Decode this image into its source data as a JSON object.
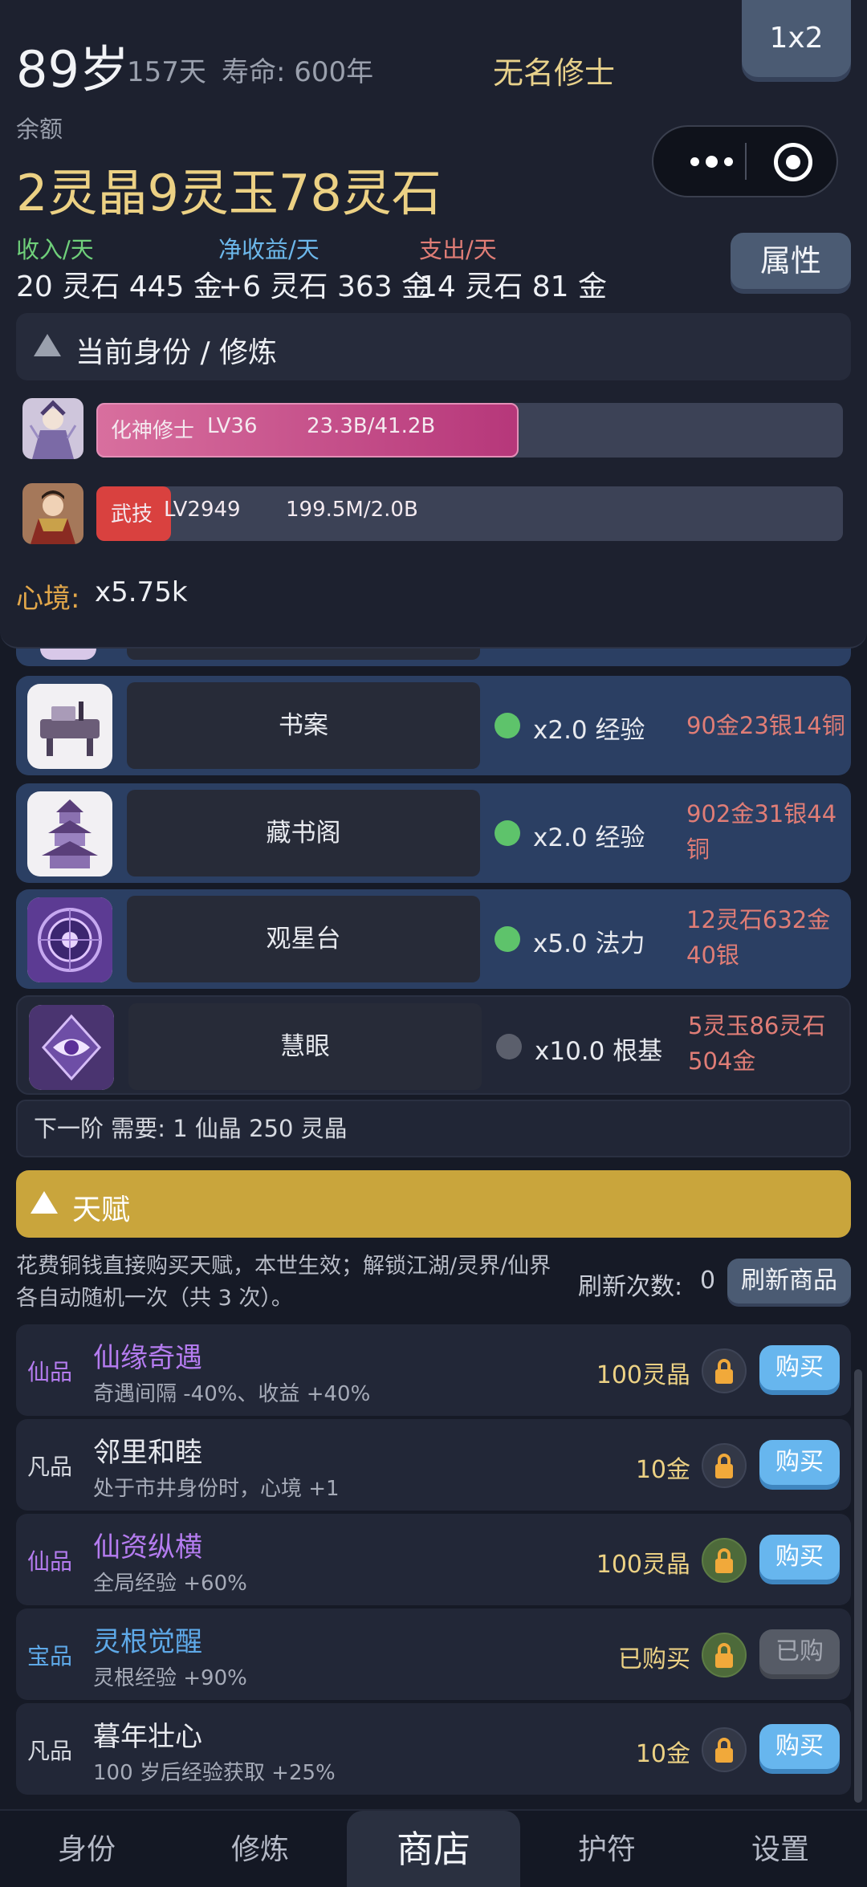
{
  "header": {
    "age": "89岁",
    "days": "157天",
    "lifespan": "寿命: 600年",
    "player_name": "无名修士",
    "layout_button": "1x2",
    "balance_label": "余额",
    "balance": "2灵晶9灵玉78灵石",
    "stats": [
      {
        "label": "收入/天",
        "value": "20 灵石 445 金",
        "color": "#6fcf7a"
      },
      {
        "label": "净收益/天",
        "value": "+6 灵石 363 金",
        "color": "#6cb7ea"
      },
      {
        "label": "支出/天",
        "value": "14 灵石 81 金",
        "color": "#e07d76"
      }
    ],
    "attributes_button": "属性"
  },
  "identity_section": {
    "title": "当前身份 / 修炼",
    "bars": [
      {
        "name": "化神修士",
        "level": "LV36",
        "progress": "23.3B/41.2B",
        "fraction": 0.566,
        "avatar_icon": "immortal-portrait-icon"
      },
      {
        "name": "武技",
        "level": "LV2949",
        "progress": "199.5M/2.0B",
        "fraction": 0.0998,
        "avatar_icon": "warrior-portrait-icon"
      }
    ],
    "mood_label": "心境:",
    "mood_value": "x5.75k"
  },
  "buildings": [
    {
      "name": "书案",
      "bonus": "x2.0 经验",
      "cost": "90金23银14铜",
      "active": true,
      "icon": "desk-icon"
    },
    {
      "name": "藏书阁",
      "bonus": "x2.0 经验",
      "cost": "902金31银44铜",
      "active": true,
      "icon": "pagoda-icon"
    },
    {
      "name": "观星台",
      "bonus": "x5.0 法力",
      "cost": "12灵石632金40银",
      "active": true,
      "icon": "star-platform-icon"
    },
    {
      "name": "慧眼",
      "bonus": "x10.0 根基",
      "cost": "5灵玉86灵石504金",
      "active": false,
      "icon": "wise-eye-icon"
    }
  ],
  "next_tier": "下一阶 需要: 1 仙晶 250 灵晶",
  "talents_section": {
    "title": "天赋",
    "description": "花费铜钱直接购买天赋，本世生效；解锁江湖/灵界/仙界各自动随机一次（共 3 次）。",
    "refresh_label": "刷新次数:",
    "refresh_count": "0",
    "refresh_button": "刷新商品",
    "items": [
      {
        "grade": "仙品",
        "grade_color": "#b57cf0",
        "name": "仙缘奇遇",
        "name_color": "#b57cf0",
        "desc": "奇遇间隔 -40%、收益 +40%",
        "price": "100灵晶",
        "button": "购买",
        "purchased": false,
        "lock_green": false
      },
      {
        "grade": "凡品",
        "grade_color": "#d6d9e0",
        "name": "邻里和睦",
        "name_color": "#e8eaef",
        "desc": "处于市井身份时，心境 +1",
        "price": "10金",
        "button": "购买",
        "purchased": false,
        "lock_green": false
      },
      {
        "grade": "仙品",
        "grade_color": "#b57cf0",
        "name": "仙资纵横",
        "name_color": "#b57cf0",
        "desc": "全局经验 +60%",
        "price": "100灵晶",
        "button": "购买",
        "purchased": false,
        "lock_green": true
      },
      {
        "grade": "宝品",
        "grade_color": "#5ea9e8",
        "name": "灵根觉醒",
        "name_color": "#5ea9e8",
        "desc": "灵根经验 +90%",
        "price": "已购买",
        "button": "已购",
        "purchased": true,
        "lock_green": true
      },
      {
        "grade": "凡品",
        "grade_color": "#d6d9e0",
        "name": "暮年壮心",
        "name_color": "#e8eaef",
        "desc": "100 岁后经验获取 +25%",
        "price": "10金",
        "button": "购买",
        "purchased": false,
        "lock_green": false
      }
    ]
  },
  "nav": {
    "items": [
      "身份",
      "修炼",
      "商店",
      "护符",
      "设置"
    ],
    "active": "商店"
  }
}
